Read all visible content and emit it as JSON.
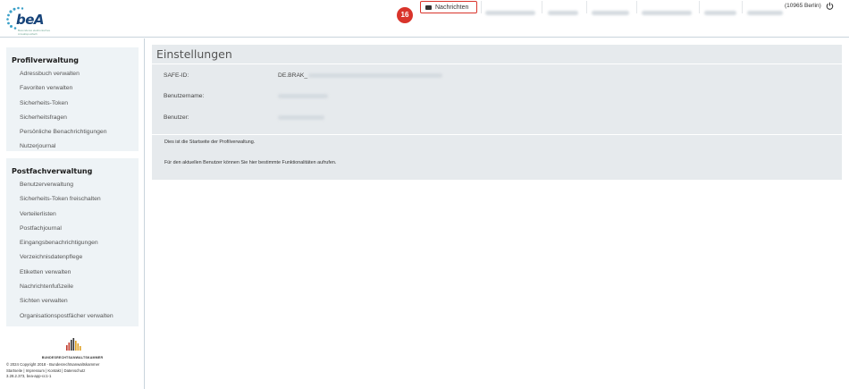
{
  "header": {
    "logo_text": "beA",
    "logo_tagline": "Besonderes elektronisches Anwaltspostfach",
    "badge_count": "16",
    "messages_label": "Nachrichten",
    "location": "(10965 Berlin)",
    "power_icon": "power-icon",
    "nav_placeholder_count": 7
  },
  "sidebar": {
    "profile_heading": "Profilverwaltung",
    "profile_items": [
      "Adressbuch verwalten",
      "Favoriten verwalten",
      "Sicherheits-Token",
      "Sicherheitsfragen",
      "Persönliche Benachrichtigungen",
      "Nutzerjournal"
    ],
    "mailbox_heading": "Postfachverwaltung",
    "mailbox_items": [
      "Benutzerverwaltung",
      "Sicherheits-Token freischalten",
      "Verteilerlisten",
      "Postfachjournal",
      "Eingangsbenachrichtigungen",
      "Verzeichnisdatenpflege",
      "Etiketten verwalten",
      "Nachrichtenfußzeile",
      "Sichten verwalten",
      "Organisationspostfächer verwalten"
    ],
    "org_name": "BUNDESRECHTSANWALTSKAMMER",
    "footer_lines": [
      "© 2024 Copyright 2018 - Bundesrechtsanwaltskammer",
      "Startseite | Impressum | Kontakt | Datenschutz",
      "3.28.2.373, bea-app-cc1-1"
    ]
  },
  "main": {
    "title": "Einstellungen",
    "safe_id_label": "SAFE-ID:",
    "safe_id_value": "DE.BRAK_",
    "username_label": "Benutzername:",
    "user_label": "Benutzer:",
    "description_lines": [
      "Dies ist die Startseite der Profilverwaltung.",
      "Für den aktuellen Benutzer können Sie hier bestimmte Funktionalitäten aufrufen."
    ]
  },
  "colors": {
    "badge": "#d9342b",
    "panel_bg": "#eef3f6",
    "main_bg": "#e6eaed",
    "logo_blue": "#17447a"
  }
}
